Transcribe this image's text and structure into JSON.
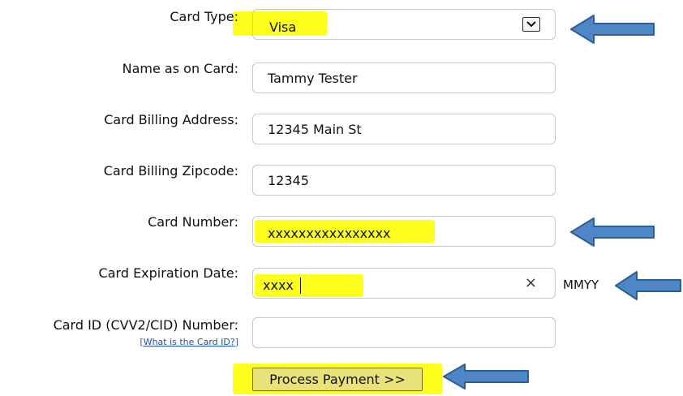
{
  "form": {
    "card_type": {
      "label": "Card Type:",
      "value": "Visa"
    },
    "name_on_card": {
      "label": "Name as on Card:",
      "value": "Tammy Tester"
    },
    "billing_address": {
      "label": "Card Billing Address:",
      "value": "12345 Main St"
    },
    "billing_zipcode": {
      "label": "Card Billing Zipcode:",
      "value": "12345"
    },
    "card_number": {
      "label": "Card Number:",
      "value": "xxxxxxxxxxxxxxxx"
    },
    "expiration_date": {
      "label": "Card Expiration Date:",
      "value": "xxxx",
      "clear_glyph": "×",
      "format_hint": "MMYY"
    },
    "card_id": {
      "label": "Card ID (CVV2/CID) Number:",
      "value": "",
      "help_open": "[",
      "help_link": "What is the Card ID?",
      "help_close": "]"
    }
  },
  "submit": {
    "label": "Process Payment >>"
  },
  "annotations": {
    "highlight_color": "#ffff1e",
    "arrow_color": "#4f86c6",
    "arrow_stroke": "#2d5f96"
  }
}
